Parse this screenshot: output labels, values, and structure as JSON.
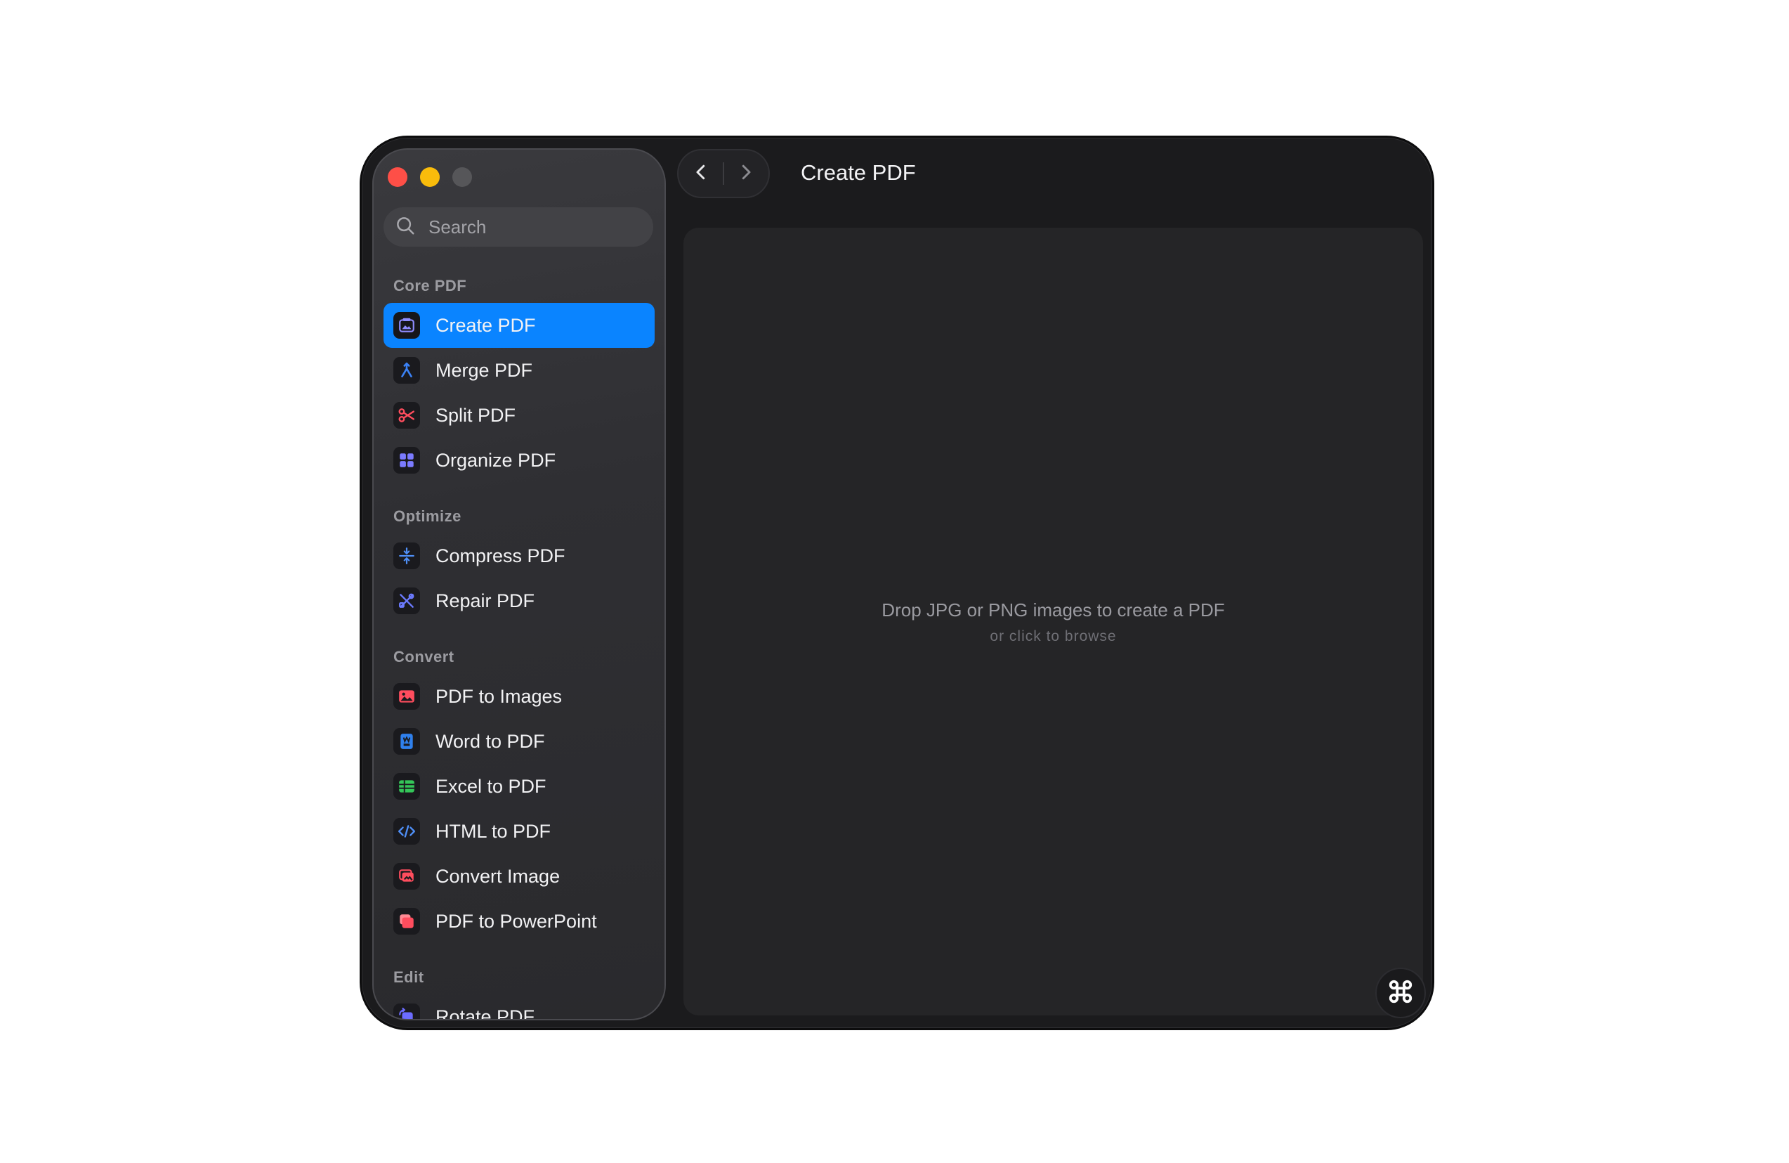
{
  "window": {
    "title": "Create PDF"
  },
  "search": {
    "placeholder": "Search"
  },
  "sidebar": {
    "sections": [
      {
        "label": "Core PDF",
        "items": [
          {
            "label": "Create PDF",
            "icon": "create-pdf-icon",
            "active": true
          },
          {
            "label": "Merge PDF",
            "icon": "merge-pdf-icon"
          },
          {
            "label": "Split PDF",
            "icon": "scissors-icon"
          },
          {
            "label": "Organize PDF",
            "icon": "grid-icon"
          }
        ]
      },
      {
        "label": "Optimize",
        "items": [
          {
            "label": "Compress PDF",
            "icon": "compress-icon"
          },
          {
            "label": "Repair PDF",
            "icon": "tools-icon"
          }
        ]
      },
      {
        "label": "Convert",
        "items": [
          {
            "label": "PDF to Images",
            "icon": "image-icon"
          },
          {
            "label": "Word to PDF",
            "icon": "word-icon"
          },
          {
            "label": "Excel to PDF",
            "icon": "table-icon"
          },
          {
            "label": "HTML to PDF",
            "icon": "code-icon"
          },
          {
            "label": "Convert Image",
            "icon": "convert-image-icon"
          },
          {
            "label": "PDF to PowerPoint",
            "icon": "powerpoint-icon"
          }
        ]
      },
      {
        "label": "Edit",
        "items": [
          {
            "label": "Rotate PDF",
            "icon": "rotate-icon"
          }
        ]
      }
    ]
  },
  "dropzone": {
    "main_text": "Drop JPG or PNG images to create a PDF",
    "sub_text": "or click to browse"
  },
  "colors": {
    "accent": "#0a84ff",
    "close": "#fe4f47",
    "minimize": "#f9bc0b",
    "window_bg": "#1b1b1d",
    "sidebar_bg": "#2f2f33",
    "dropzone_bg": "#252527"
  }
}
